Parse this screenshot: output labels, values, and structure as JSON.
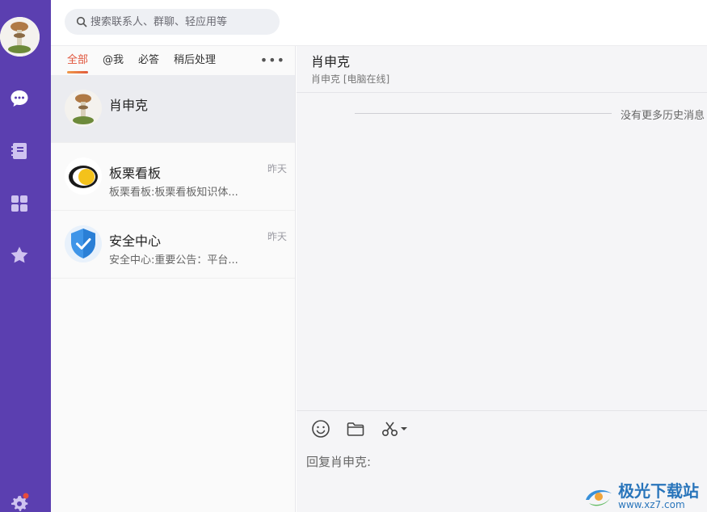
{
  "search": {
    "placeholder": "搜索联系人、群聊、轻应用等"
  },
  "sidebar": {
    "items": [
      {
        "name": "messages"
      },
      {
        "name": "contacts"
      },
      {
        "name": "apps"
      },
      {
        "name": "favorites"
      },
      {
        "name": "settings"
      }
    ]
  },
  "filters": {
    "tabs": [
      "全部",
      "@我",
      "必答",
      "稍后处理"
    ],
    "more": "•••"
  },
  "conversations": [
    {
      "name": "肖申克",
      "preview": "",
      "time": ""
    },
    {
      "name": "板栗看板",
      "preview": "板栗看板:板栗看板知识体...",
      "time": "昨天"
    },
    {
      "name": "安全中心",
      "preview": "安全中心:重要公告：平台...",
      "time": "昨天"
    }
  ],
  "chat": {
    "title": "肖申克",
    "subtitle": "肖申克  [电脑在线]",
    "history_text": "没有更多历史消息",
    "input_placeholder": "回复肖申克:"
  },
  "watermark": {
    "text": "极光下载站",
    "url": "www.xz7.com"
  },
  "colors": {
    "rail": "#5b3fb0",
    "accent": "#e0553c",
    "badge": "#e74c3c"
  }
}
